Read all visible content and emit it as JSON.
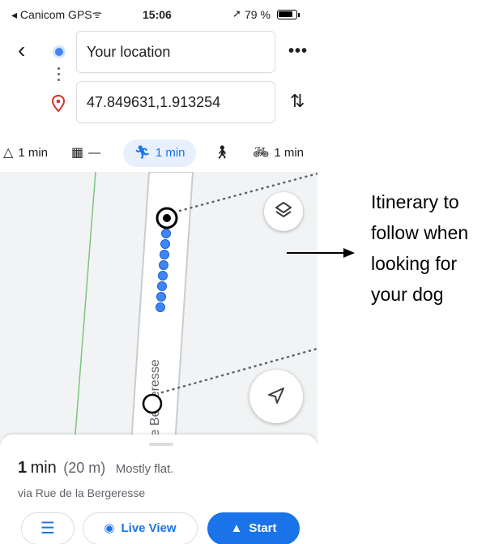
{
  "status_bar": {
    "carrier": "◂ Canicom GPS",
    "time": "15:06",
    "battery": "79 %"
  },
  "route": {
    "origin": "Your location",
    "destination": "47.849631,1.913254"
  },
  "modes": [
    {
      "id": "car",
      "icon": "car-icon",
      "label": "1 min"
    },
    {
      "id": "transit",
      "icon": "transit-icon",
      "label": "—"
    },
    {
      "id": "walk",
      "icon": "walk-icon",
      "label": "1 min",
      "selected": true
    },
    {
      "id": "ride",
      "icon": "ride-icon",
      "label": ""
    },
    {
      "id": "bike",
      "icon": "bike-icon",
      "label": "1 min"
    }
  ],
  "map": {
    "street_label": "le Bergeresse",
    "route_color": "#4285f4"
  },
  "sheet": {
    "duration_num": "1",
    "duration_unit": "min",
    "distance": "(20 m)",
    "terrain": "Mostly flat.",
    "via": "via Rue de la Bergeresse",
    "live_view": "Live View",
    "start": "Start"
  },
  "annotation": {
    "lines": [
      "Itinerary to",
      "follow when",
      "looking for",
      "your dog"
    ]
  },
  "colors": {
    "accent": "#1a73e8",
    "selected_mode_bg": "#e8f0fe"
  }
}
